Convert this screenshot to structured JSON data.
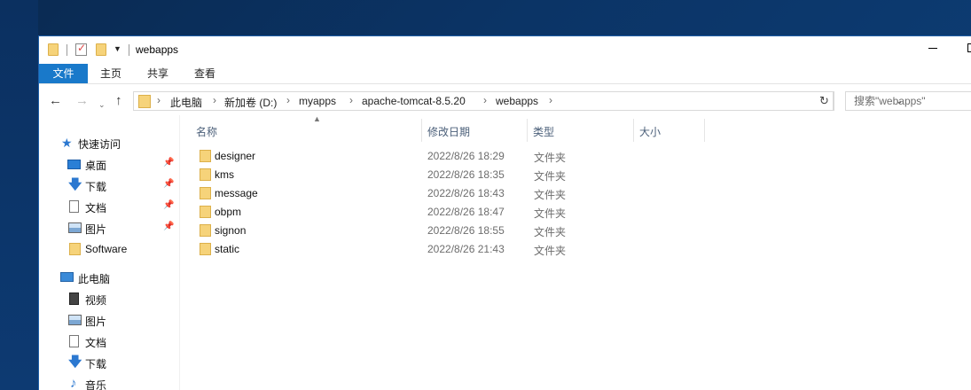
{
  "window": {
    "title": "webapps"
  },
  "ribbon": {
    "tabs": [
      {
        "label": "文件",
        "active": true
      },
      {
        "label": "主页",
        "active": false
      },
      {
        "label": "共享",
        "active": false
      },
      {
        "label": "查看",
        "active": false
      }
    ]
  },
  "address": {
    "crumbs": [
      "此电脑",
      "新加卷 (D:)",
      "myapps",
      "apache-tomcat-8.5.20",
      "webapps"
    ],
    "search_placeholder": "搜索\"webapps\""
  },
  "navpane": {
    "quick_access": "快速访问",
    "items": [
      {
        "label": "桌面",
        "icon": "desktop-icon",
        "pinned": true
      },
      {
        "label": "下载",
        "icon": "download-icon",
        "pinned": true
      },
      {
        "label": "文档",
        "icon": "document-icon",
        "pinned": true
      },
      {
        "label": "图片",
        "icon": "picture-icon",
        "pinned": true
      },
      {
        "label": "Software",
        "icon": "folder-icon",
        "pinned": false
      }
    ],
    "this_pc": "此电脑",
    "pc_items": [
      {
        "label": "视频",
        "icon": "video-icon"
      },
      {
        "label": "图片",
        "icon": "picture-icon"
      },
      {
        "label": "文档",
        "icon": "document-icon"
      },
      {
        "label": "下载",
        "icon": "download-icon"
      },
      {
        "label": "音乐",
        "icon": "music-icon"
      }
    ]
  },
  "columns": {
    "name": "名称",
    "date": "修改日期",
    "type": "类型",
    "size": "大小"
  },
  "files": [
    {
      "name": "designer",
      "date": "2022/8/26 18:29",
      "type": "文件夹"
    },
    {
      "name": "kms",
      "date": "2022/8/26 18:35",
      "type": "文件夹"
    },
    {
      "name": "message",
      "date": "2022/8/26 18:43",
      "type": "文件夹"
    },
    {
      "name": "obpm",
      "date": "2022/8/26 18:47",
      "type": "文件夹"
    },
    {
      "name": "signon",
      "date": "2022/8/26 18:55",
      "type": "文件夹"
    },
    {
      "name": "static",
      "date": "2022/8/26 21:43",
      "type": "文件夹"
    }
  ],
  "colors": {
    "accent": "#1979ca",
    "folder": "#f6d37a",
    "desktop_bg": "#0b3466"
  }
}
